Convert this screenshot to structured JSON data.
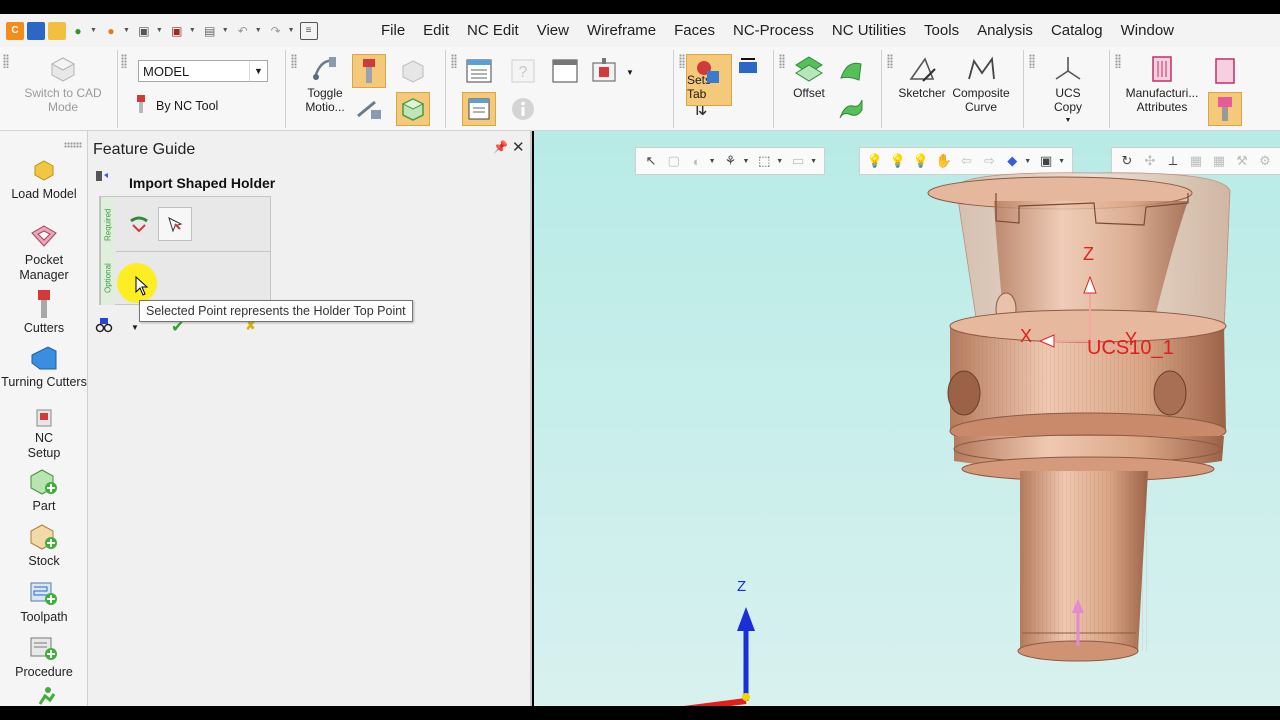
{
  "menubar": {
    "items": [
      "File",
      "Edit",
      "NC Edit",
      "View",
      "Wireframe",
      "Faces",
      "NC-Process",
      "NC Utilities",
      "Tools",
      "Analysis",
      "Catalog",
      "Window"
    ]
  },
  "ribbon": {
    "switch_to_cad": "Switch to CAD Mode",
    "model_select": "MODEL",
    "by_nc_tool": "By NC Tool",
    "toggle_motion": "Toggle Motio...",
    "sets_tab": "Sets Tab",
    "offset": "Offset",
    "sketcher": "Sketcher",
    "composite_curve": "Composite Curve",
    "ucs_copy": "UCS Copy",
    "manufacturing_attributes": "Manufacturi... Attributes"
  },
  "toolbox": {
    "items": [
      "Load Model",
      "Pocket Manager",
      "Cutters",
      "Turning Cutters",
      "NC Setup",
      "Part",
      "Stock",
      "Toolpath",
      "Procedure"
    ]
  },
  "feature_guide": {
    "title": "Feature Guide",
    "heading": "Import Shaped Holder",
    "required_label": "Required",
    "optional_label": "Optional",
    "tooltip": "Selected Point represents the Holder Top Point"
  },
  "viewport": {
    "ucs_label": "UCS10_1",
    "axis_z_top": "Z",
    "axis_x_top": "X",
    "axis_y_top": "Y",
    "axis_z_bottom": "Z"
  },
  "colors": {
    "accent_orange": "#f5c97a",
    "viewport_bg": "#c8eeeb",
    "ucs_red": "#e0201c",
    "axis_blue": "#1a2fd8"
  }
}
